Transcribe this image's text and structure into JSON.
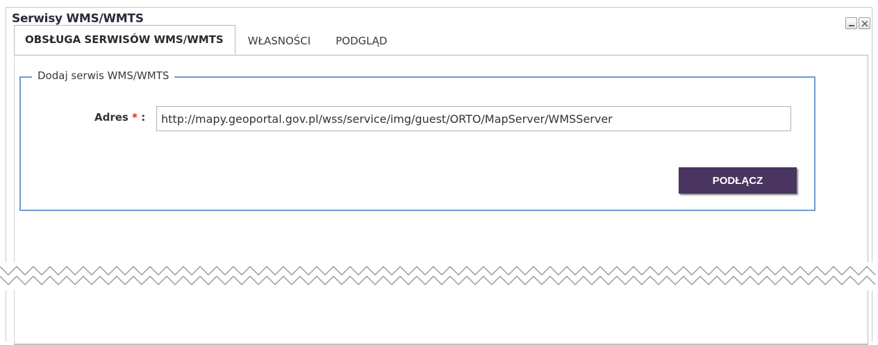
{
  "window": {
    "title": "Serwisy WMS/WMTS",
    "buttons": {
      "minimize_icon": "minimize-icon",
      "close_icon": "close-icon"
    }
  },
  "tabs": [
    {
      "label": "OBSŁUGA SERWISÓW WMS/WMTS",
      "active": true
    },
    {
      "label": "WŁASNOŚCI",
      "active": false
    },
    {
      "label": "PODGLĄD",
      "active": false
    }
  ],
  "add_service": {
    "legend": "Dodaj serwis WMS/WMTS",
    "address_label": "Adres",
    "required_marker": "*",
    "label_suffix": ":",
    "address_value": "http://mapy.geoportal.gov.pl/wss/service/img/guest/ORTO/MapServer/WMSServer",
    "connect_label": "PODŁĄCZ"
  },
  "colors": {
    "accent_border": "#6f9bd0",
    "button_bg": "#4a3560",
    "required": "#e02020"
  }
}
